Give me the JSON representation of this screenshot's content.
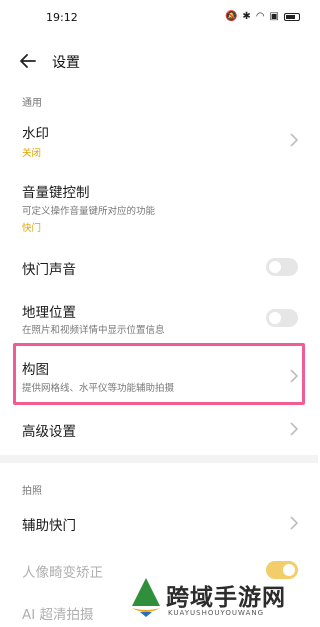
{
  "status": {
    "time": "19:12"
  },
  "header": {
    "title": "设置"
  },
  "sections": {
    "general": "通用",
    "photo": "拍照"
  },
  "rows": {
    "watermark": {
      "title": "水印",
      "value": "关闭"
    },
    "volume_key": {
      "title": "音量键控制",
      "subtitle": "可定义操作音量键所对应的功能",
      "value": "快门"
    },
    "shutter_sound": {
      "title": "快门声音",
      "toggle": false
    },
    "location": {
      "title": "地理位置",
      "subtitle": "在照片和视频详情中显示位置信息",
      "toggle": false
    },
    "composition": {
      "title": "构图",
      "subtitle": "提供网格线、水平仪等功能辅助拍摄"
    },
    "advanced": {
      "title": "高级设置"
    },
    "assist_shutter": {
      "title": "辅助快门"
    },
    "portrait_correction": {
      "title": "人像畸变矫正",
      "toggle": true
    },
    "ai_hd": {
      "title": "AI 超清拍摄"
    }
  },
  "watermark_overlay": {
    "name": "跨域手游网",
    "domain": "KUAYUSHOUYOUWANG"
  },
  "colors": {
    "accent": "#e0a400",
    "highlight": "#f25c95"
  }
}
